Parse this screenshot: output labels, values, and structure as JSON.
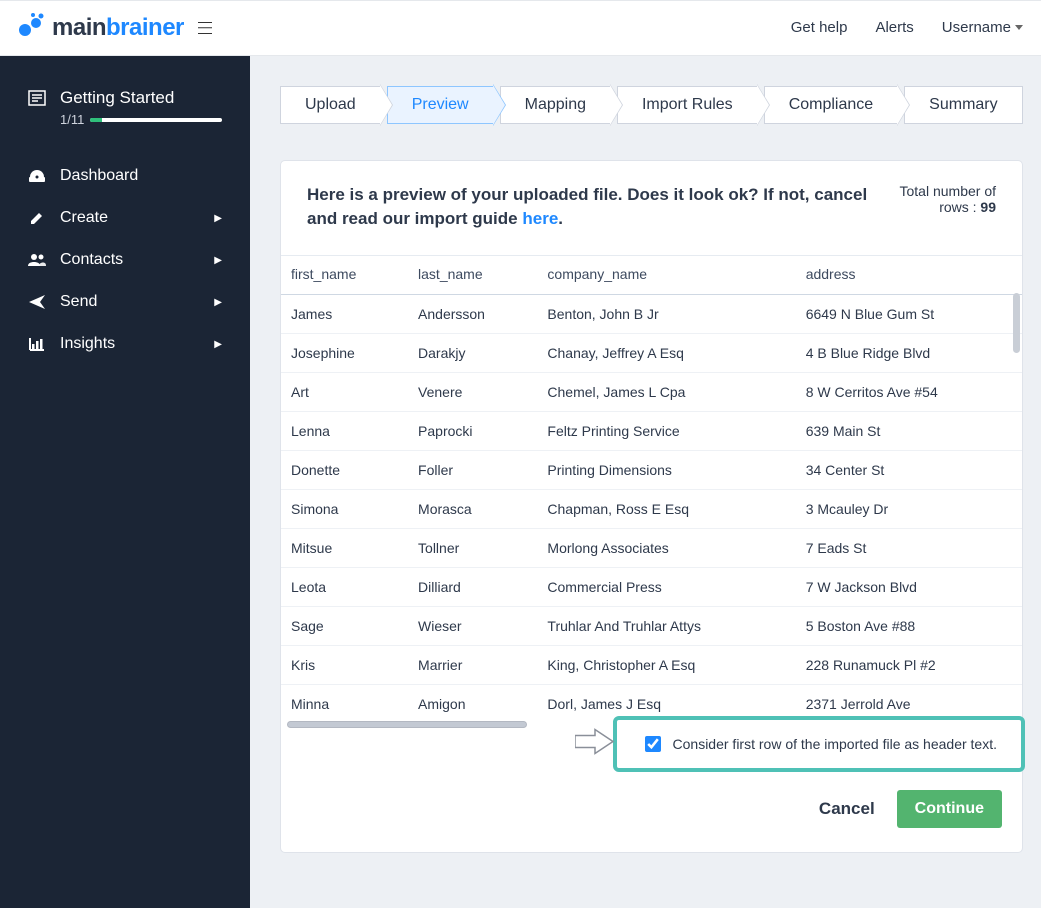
{
  "brand": {
    "part1": "main",
    "part2": "brainer",
    "color1": "#2e394b",
    "color2": "#1e88ff"
  },
  "topnav": {
    "help": "Get help",
    "alerts": "Alerts",
    "user": "Username"
  },
  "sidebar": {
    "getting_started": {
      "icon": "newspaper-icon",
      "title": "Getting Started",
      "progress_label": "1/11"
    },
    "items": [
      {
        "icon": "gauge-icon",
        "label": "Dashboard",
        "expandable": false
      },
      {
        "icon": "pencil-icon",
        "label": "Create",
        "expandable": true
      },
      {
        "icon": "users-icon",
        "label": "Contacts",
        "expandable": true
      },
      {
        "icon": "send-icon",
        "label": "Send",
        "expandable": true
      },
      {
        "icon": "chart-icon",
        "label": "Insights",
        "expandable": true
      }
    ]
  },
  "wizard": {
    "steps": [
      "Upload",
      "Preview",
      "Mapping",
      "Import Rules",
      "Compliance",
      "Summary"
    ],
    "active_index": 1
  },
  "preview": {
    "heading_pre": "Here is a preview of your uploaded file. Does it look ok? If not, cancel and read our import guide ",
    "heading_link": "here",
    "heading_post": ".",
    "total_label": "Total number of rows : ",
    "total_value": "99",
    "columns": [
      "first_name",
      "last_name",
      "company_name",
      "address"
    ],
    "rows": [
      [
        "James",
        "Andersson",
        "Benton, John B Jr",
        "6649 N Blue Gum St"
      ],
      [
        "Josephine",
        "Darakjy",
        "Chanay, Jeffrey A Esq",
        "4 B Blue Ridge Blvd"
      ],
      [
        "Art",
        "Venere",
        "Chemel, James L Cpa",
        "8 W Cerritos Ave #54"
      ],
      [
        "Lenna",
        "Paprocki",
        "Feltz Printing Service",
        "639 Main St"
      ],
      [
        "Donette",
        "Foller",
        "Printing Dimensions",
        "34 Center St"
      ],
      [
        "Simona",
        "Morasca",
        "Chapman, Ross E Esq",
        "3 Mcauley Dr"
      ],
      [
        "Mitsue",
        "Tollner",
        "Morlong Associates",
        "7 Eads St"
      ],
      [
        "Leota",
        "Dilliard",
        "Commercial Press",
        "7 W Jackson Blvd"
      ],
      [
        "Sage",
        "Wieser",
        "Truhlar And Truhlar Attys",
        "5 Boston Ave #88"
      ],
      [
        "Kris",
        "Marrier",
        "King, Christopher A Esq",
        "228 Runamuck Pl #2"
      ],
      [
        "Minna",
        "Amigon",
        "Dorl, James J Esq",
        "2371 Jerrold Ave"
      ]
    ],
    "checkbox_label": "Consider first row of the imported file as header text.",
    "checkbox_checked": true,
    "cancel": "Cancel",
    "continue": "Continue"
  }
}
